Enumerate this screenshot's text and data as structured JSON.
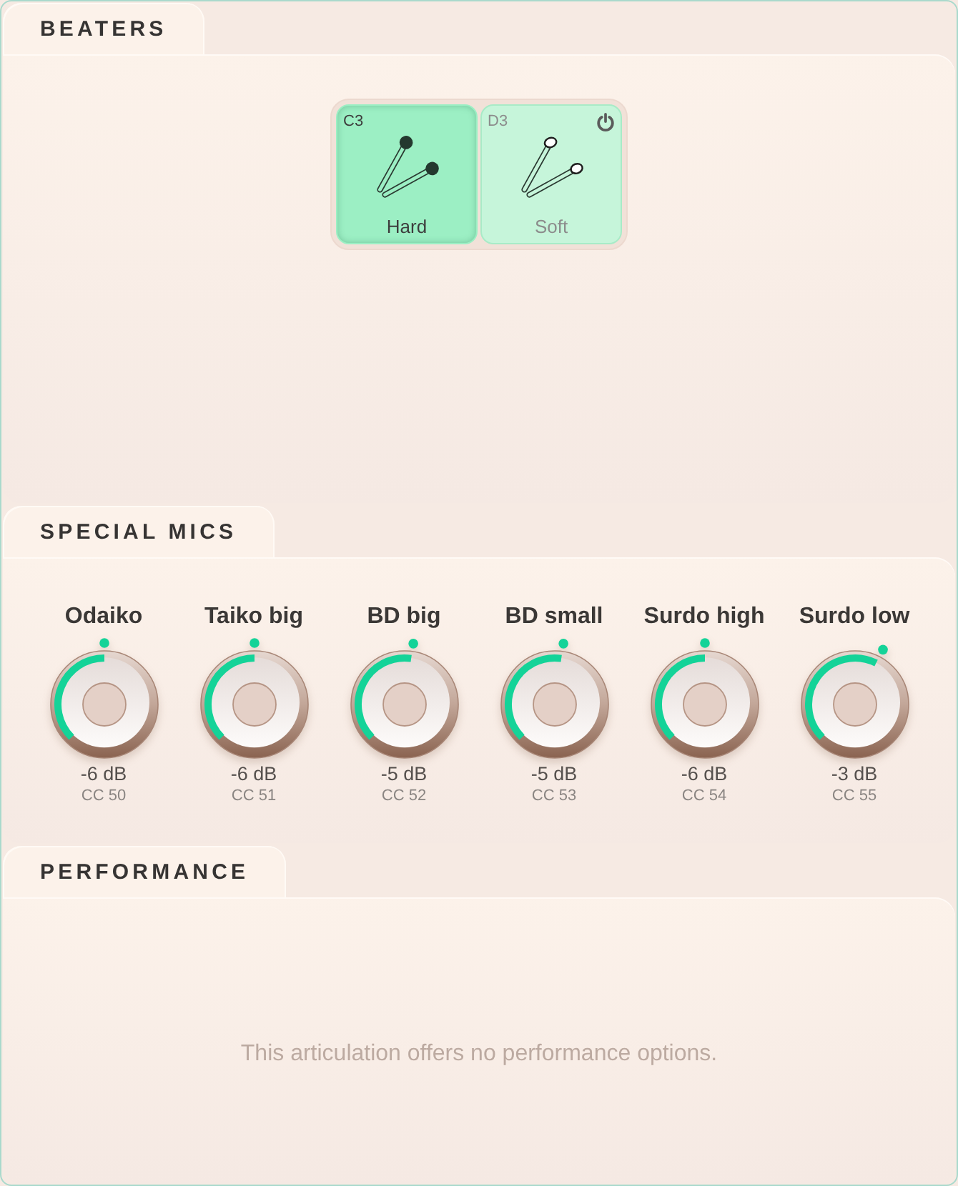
{
  "beaters": {
    "title": "BEATERS",
    "items": [
      {
        "kind": "hard",
        "note": "C3",
        "label": "Hard",
        "selected": true,
        "power_toggle": false
      },
      {
        "kind": "soft",
        "note": "D3",
        "label": "Soft",
        "selected": false,
        "power_toggle": true
      }
    ]
  },
  "special_mics": {
    "title": "SPECIAL MICS",
    "mics": [
      {
        "name": "Odaiko",
        "level": 0.5,
        "reading": "-6 dB",
        "cc": "CC 50"
      },
      {
        "name": "Taiko big",
        "level": 0.5,
        "reading": "-6 dB",
        "cc": "CC 51"
      },
      {
        "name": "BD big",
        "level": 0.53,
        "reading": "-5 dB",
        "cc": "CC 52"
      },
      {
        "name": "BD small",
        "level": 0.53,
        "reading": "-5 dB",
        "cc": "CC 53"
      },
      {
        "name": "Surdo high",
        "level": 0.5,
        "reading": "-6 dB",
        "cc": "CC 54"
      },
      {
        "name": "Surdo low",
        "level": 0.6,
        "reading": "-3 dB",
        "cc": "CC 55"
      }
    ]
  },
  "performance": {
    "title": "PERFORMANCE",
    "message": "This articulation offers no performance options."
  }
}
